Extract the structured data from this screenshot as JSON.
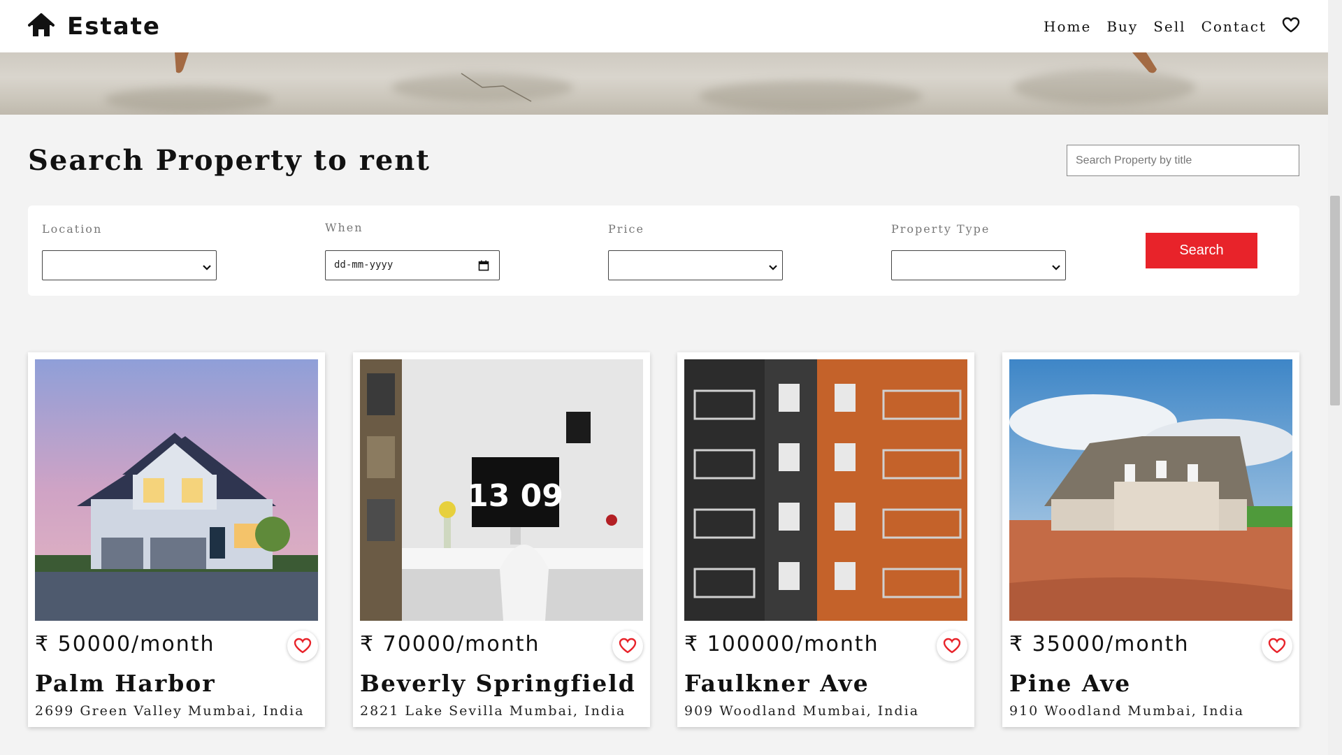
{
  "nav": {
    "brand": "Estate",
    "links": [
      "Home",
      "Buy",
      "Sell",
      "Contact"
    ]
  },
  "search": {
    "heading": "Search Property to rent",
    "title_placeholder": "Search Property by title",
    "filters": {
      "location_label": "Location",
      "when_label": "When",
      "when_value": "dd-mm-yyyy",
      "price_label": "Price",
      "type_label": "Property Type"
    },
    "button_label": "Search"
  },
  "listings": [
    {
      "price": "₹ 50000/month",
      "title": "Palm Harbor",
      "address": "2699 Green Valley Mumbai, India"
    },
    {
      "price": "₹ 70000/month",
      "title": "Beverly Springfield",
      "address": "2821 Lake Sevilla Mumbai, India"
    },
    {
      "price": "₹ 100000/month",
      "title": "Faulkner Ave",
      "address": "909 Woodland Mumbai, India"
    },
    {
      "price": "₹ 35000/month",
      "title": "Pine Ave",
      "address": "910 Woodland Mumbai, India"
    }
  ],
  "images": {
    "card_1": {
      "clock": "13 09"
    }
  },
  "colors": {
    "accent": "#e8232a",
    "heart": "#e8232a",
    "background": "#f3f3f3"
  },
  "icons": [
    "home-icon",
    "heart-icon",
    "chevron-down-icon",
    "calendar-icon"
  ]
}
